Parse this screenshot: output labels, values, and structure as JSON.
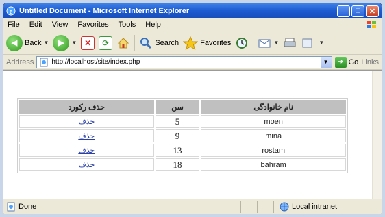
{
  "window": {
    "title": "Untitled Document - Microsoft Internet Explorer",
    "minimize": "_",
    "maximize": "□",
    "close": "✕"
  },
  "menu": [
    "File",
    "Edit",
    "View",
    "Favorites",
    "Tools",
    "Help"
  ],
  "toolbar": {
    "back_label": "Back",
    "search_label": "Search",
    "favorites_label": "Favorites"
  },
  "address": {
    "label": "Address",
    "url": "http://localhost/site/index.php",
    "go_label": "Go",
    "links_label": "Links"
  },
  "table": {
    "headers": [
      "حذف رکورد",
      "سن",
      "نام خانوادگی"
    ],
    "rows": [
      {
        "action": "حذف",
        "age": "5",
        "name": "moen"
      },
      {
        "action": "حذف",
        "age": "9",
        "name": "mina"
      },
      {
        "action": "حذف",
        "age": "13",
        "name": "rostam"
      },
      {
        "action": "حذف",
        "age": "18",
        "name": "bahram"
      }
    ]
  },
  "status": {
    "text": "Done",
    "zone": "Local intranet"
  },
  "colors": {
    "titlebar": "#1d5cd3",
    "header_bg": "#c0c0c0",
    "link": "#2a3fa8"
  }
}
